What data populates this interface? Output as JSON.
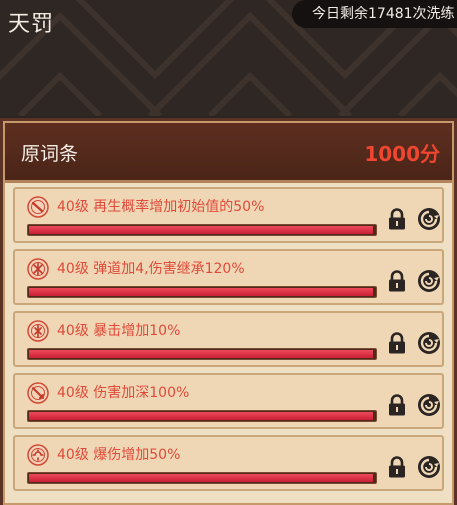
{
  "header": {
    "title": "天罚",
    "remaining": "今日剩余17481次洗练"
  },
  "panel": {
    "label": "原词条",
    "score": "1000分"
  },
  "affixes": [
    {
      "text": "40级 再生概率增加初始值的50%",
      "icon": "bullet-icon",
      "fill": 1.0
    },
    {
      "text": "40级 弹道加4,伤害继承120%",
      "icon": "spark-icon",
      "fill": 1.0
    },
    {
      "text": "40级 暴击增加10%",
      "icon": "crit-icon",
      "fill": 1.0
    },
    {
      "text": "40级 伤害加深100%",
      "icon": "sword-icon",
      "fill": 1.0
    },
    {
      "text": "40级 爆伤增加50%",
      "icon": "burst-icon",
      "fill": 1.0
    }
  ],
  "colors": {
    "affix_text": "#e04a3a",
    "score": "#ef4631",
    "bar_fill": "#d92a40"
  }
}
